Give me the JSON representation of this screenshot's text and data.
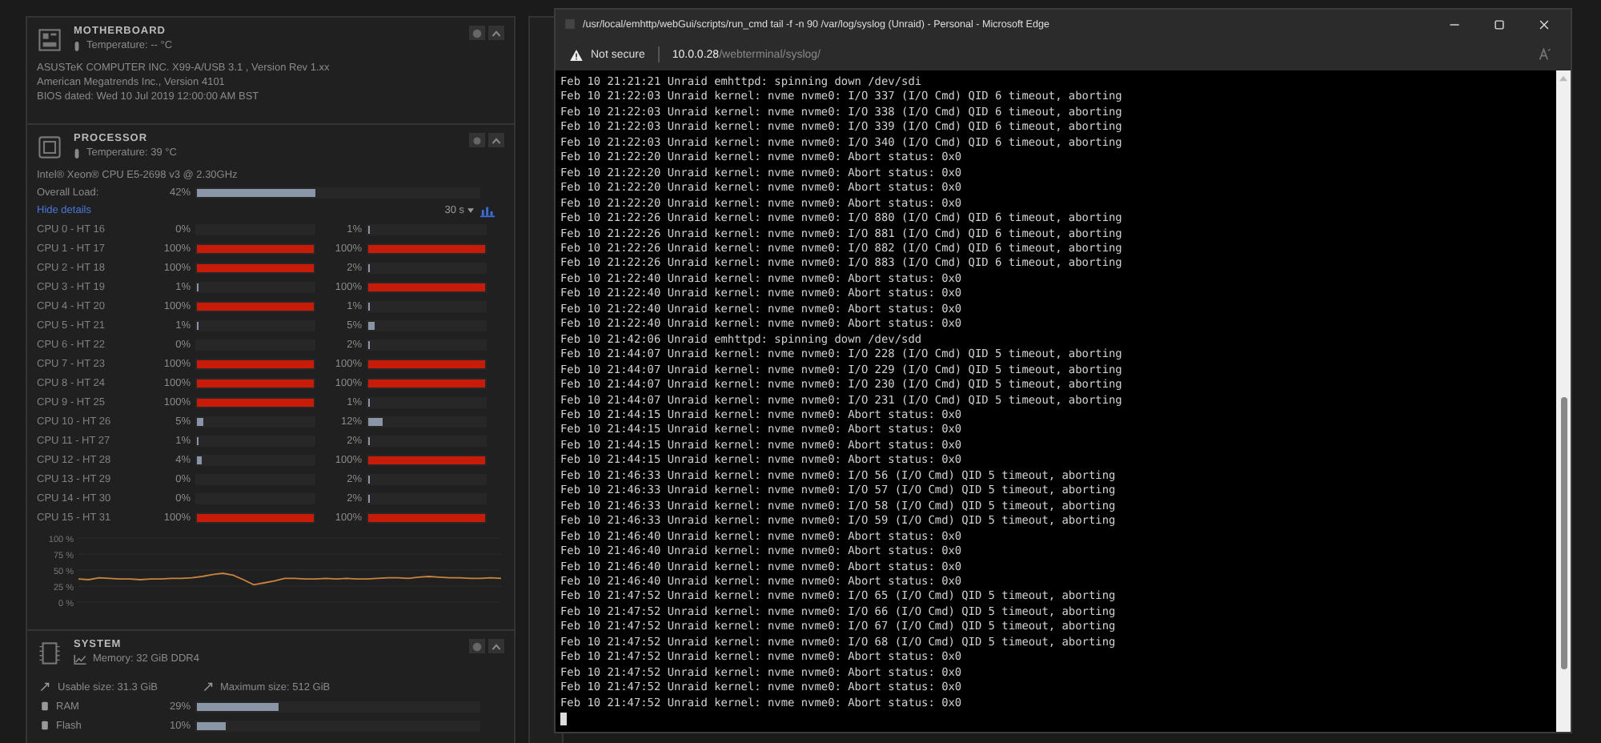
{
  "motherboard": {
    "title": "MOTHERBOARD",
    "temperature": "Temperature: -- °C",
    "lines": [
      "ASUSTeK COMPUTER INC. X99-A/USB 3.1 , Version Rev 1.xx",
      "American Megatrends Inc., Version 4101",
      "BIOS dated: Wed 10 Jul 2019 12:00:00 AM BST"
    ]
  },
  "processor": {
    "title": "PROCESSOR",
    "temperature": "Temperature: 39 °C",
    "model": "Intel® Xeon® CPU E5-2698 v3 @ 2.30GHz",
    "overall": {
      "label": "Overall Load:",
      "reading": "42%",
      "level": 0.42
    },
    "hide_details": "Hide details",
    "interval": "30 s",
    "cpus": [
      {
        "label": "CPU 0 - HT 16",
        "a": {
          "reading": "0%",
          "level": 0
        },
        "b": {
          "reading": "1%",
          "level": 0.01
        }
      },
      {
        "label": "CPU 1 - HT 17",
        "a": {
          "reading": "100%",
          "level": 1
        },
        "b": {
          "reading": "100%",
          "level": 1
        }
      },
      {
        "label": "CPU 2 - HT 18",
        "a": {
          "reading": "100%",
          "level": 1
        },
        "b": {
          "reading": "2%",
          "level": 0.02
        }
      },
      {
        "label": "CPU 3 - HT 19",
        "a": {
          "reading": "1%",
          "level": 0.01
        },
        "b": {
          "reading": "100%",
          "level": 1
        }
      },
      {
        "label": "CPU 4 - HT 20",
        "a": {
          "reading": "100%",
          "level": 1
        },
        "b": {
          "reading": "1%",
          "level": 0.01
        }
      },
      {
        "label": "CPU 5 - HT 21",
        "a": {
          "reading": "1%",
          "level": 0.01
        },
        "b": {
          "reading": "5%",
          "level": 0.05
        }
      },
      {
        "label": "CPU 6 - HT 22",
        "a": {
          "reading": "0%",
          "level": 0
        },
        "b": {
          "reading": "2%",
          "level": 0.02
        }
      },
      {
        "label": "CPU 7 - HT 23",
        "a": {
          "reading": "100%",
          "level": 1
        },
        "b": {
          "reading": "100%",
          "level": 1
        }
      },
      {
        "label": "CPU 8 - HT 24",
        "a": {
          "reading": "100%",
          "level": 1
        },
        "b": {
          "reading": "100%",
          "level": 1
        }
      },
      {
        "label": "CPU 9 - HT 25",
        "a": {
          "reading": "100%",
          "level": 1
        },
        "b": {
          "reading": "1%",
          "level": 0.01
        }
      },
      {
        "label": "CPU 10 - HT 26",
        "a": {
          "reading": "5%",
          "level": 0.05
        },
        "b": {
          "reading": "12%",
          "level": 0.12
        }
      },
      {
        "label": "CPU 11 - HT 27",
        "a": {
          "reading": "1%",
          "level": 0.01
        },
        "b": {
          "reading": "2%",
          "level": 0.02
        }
      },
      {
        "label": "CPU 12 - HT 28",
        "a": {
          "reading": "4%",
          "level": 0.04
        },
        "b": {
          "reading": "100%",
          "level": 1
        }
      },
      {
        "label": "CPU 13 - HT 29",
        "a": {
          "reading": "0%",
          "level": 0
        },
        "b": {
          "reading": "2%",
          "level": 0.02
        }
      },
      {
        "label": "CPU 14 - HT 30",
        "a": {
          "reading": "0%",
          "level": 0
        },
        "b": {
          "reading": "2%",
          "level": 0.02
        }
      },
      {
        "label": "CPU 15 - HT 31",
        "a": {
          "reading": "100%",
          "level": 1
        },
        "b": {
          "reading": "100%",
          "level": 1
        }
      }
    ],
    "chart_data": {
      "type": "line",
      "grid": true,
      "ylim": [
        0,
        100
      ],
      "yticks": [
        {
          "value": 100,
          "label": "100 %"
        },
        {
          "value": 75,
          "label": "75 %"
        },
        {
          "value": 50,
          "label": "50 %"
        },
        {
          "value": 25,
          "label": "25 %"
        },
        {
          "value": 0,
          "label": "0 %"
        }
      ],
      "values": [
        36,
        35,
        38,
        37,
        36,
        36,
        35,
        36,
        36,
        37,
        37,
        38,
        40,
        43,
        45,
        42,
        35,
        27,
        30,
        33,
        37,
        37,
        36,
        36,
        37,
        36,
        37,
        36,
        36,
        37,
        38,
        38,
        37,
        39,
        40,
        39,
        38,
        38,
        37,
        37,
        38,
        37
      ]
    }
  },
  "system": {
    "title": "SYSTEM",
    "memory": "Memory: 32 GiB DDR4",
    "usable": "Usable size: 31.3 GiB",
    "maximum": "Maximum size: 512 GiB",
    "bars": [
      {
        "label": "RAM",
        "reading": "29%",
        "level": 0.29
      },
      {
        "label": "Flash",
        "reading": "10%",
        "level": 0.1
      }
    ]
  },
  "browser": {
    "title": "/usr/local/emhttp/webGui/scripts/run_cmd tail -f -n 90 /var/log/syslog (Unraid) - Personal - Microsoft Edge",
    "security": "Not secure",
    "host": "10.0.0.28",
    "path": "/webterminal/syslog/",
    "log": [
      "Feb 10 21:21:21 Unraid emhttpd: spinning down /dev/sdi",
      "Feb 10 21:22:03 Unraid kernel: nvme nvme0: I/O 337 (I/O Cmd) QID 6 timeout, aborting",
      "Feb 10 21:22:03 Unraid kernel: nvme nvme0: I/O 338 (I/O Cmd) QID 6 timeout, aborting",
      "Feb 10 21:22:03 Unraid kernel: nvme nvme0: I/O 339 (I/O Cmd) QID 6 timeout, aborting",
      "Feb 10 21:22:03 Unraid kernel: nvme nvme0: I/O 340 (I/O Cmd) QID 6 timeout, aborting",
      "Feb 10 21:22:20 Unraid kernel: nvme nvme0: Abort status: 0x0",
      "Feb 10 21:22:20 Unraid kernel: nvme nvme0: Abort status: 0x0",
      "Feb 10 21:22:20 Unraid kernel: nvme nvme0: Abort status: 0x0",
      "Feb 10 21:22:20 Unraid kernel: nvme nvme0: Abort status: 0x0",
      "Feb 10 21:22:26 Unraid kernel: nvme nvme0: I/O 880 (I/O Cmd) QID 6 timeout, aborting",
      "Feb 10 21:22:26 Unraid kernel: nvme nvme0: I/O 881 (I/O Cmd) QID 6 timeout, aborting",
      "Feb 10 21:22:26 Unraid kernel: nvme nvme0: I/O 882 (I/O Cmd) QID 6 timeout, aborting",
      "Feb 10 21:22:26 Unraid kernel: nvme nvme0: I/O 883 (I/O Cmd) QID 6 timeout, aborting",
      "Feb 10 21:22:40 Unraid kernel: nvme nvme0: Abort status: 0x0",
      "Feb 10 21:22:40 Unraid kernel: nvme nvme0: Abort status: 0x0",
      "Feb 10 21:22:40 Unraid kernel: nvme nvme0: Abort status: 0x0",
      "Feb 10 21:22:40 Unraid kernel: nvme nvme0: Abort status: 0x0",
      "Feb 10 21:42:06 Unraid emhttpd: spinning down /dev/sdd",
      "Feb 10 21:44:07 Unraid kernel: nvme nvme0: I/O 228 (I/O Cmd) QID 5 timeout, aborting",
      "Feb 10 21:44:07 Unraid kernel: nvme nvme0: I/O 229 (I/O Cmd) QID 5 timeout, aborting",
      "Feb 10 21:44:07 Unraid kernel: nvme nvme0: I/O 230 (I/O Cmd) QID 5 timeout, aborting",
      "Feb 10 21:44:07 Unraid kernel: nvme nvme0: I/O 231 (I/O Cmd) QID 5 timeout, aborting",
      "Feb 10 21:44:15 Unraid kernel: nvme nvme0: Abort status: 0x0",
      "Feb 10 21:44:15 Unraid kernel: nvme nvme0: Abort status: 0x0",
      "Feb 10 21:44:15 Unraid kernel: nvme nvme0: Abort status: 0x0",
      "Feb 10 21:44:15 Unraid kernel: nvme nvme0: Abort status: 0x0",
      "Feb 10 21:46:33 Unraid kernel: nvme nvme0: I/O 56 (I/O Cmd) QID 5 timeout, aborting",
      "Feb 10 21:46:33 Unraid kernel: nvme nvme0: I/O 57 (I/O Cmd) QID 5 timeout, aborting",
      "Feb 10 21:46:33 Unraid kernel: nvme nvme0: I/O 58 (I/O Cmd) QID 5 timeout, aborting",
      "Feb 10 21:46:33 Unraid kernel: nvme nvme0: I/O 59 (I/O Cmd) QID 5 timeout, aborting",
      "Feb 10 21:46:40 Unraid kernel: nvme nvme0: Abort status: 0x0",
      "Feb 10 21:46:40 Unraid kernel: nvme nvme0: Abort status: 0x0",
      "Feb 10 21:46:40 Unraid kernel: nvme nvme0: Abort status: 0x0",
      "Feb 10 21:46:40 Unraid kernel: nvme nvme0: Abort status: 0x0",
      "Feb 10 21:47:52 Unraid kernel: nvme nvme0: I/O 65 (I/O Cmd) QID 5 timeout, aborting",
      "Feb 10 21:47:52 Unraid kernel: nvme nvme0: I/O 66 (I/O Cmd) QID 5 timeout, aborting",
      "Feb 10 21:47:52 Unraid kernel: nvme nvme0: I/O 67 (I/O Cmd) QID 5 timeout, aborting",
      "Feb 10 21:47:52 Unraid kernel: nvme nvme0: I/O 68 (I/O Cmd) QID 5 timeout, aborting",
      "Feb 10 21:47:52 Unraid kernel: nvme nvme0: Abort status: 0x0",
      "Feb 10 21:47:52 Unraid kernel: nvme nvme0: Abort status: 0x0",
      "Feb 10 21:47:52 Unraid kernel: nvme nvme0: Abort status: 0x0",
      "Feb 10 21:47:52 Unraid kernel: nvme nvme0: Abort status: 0x0"
    ]
  }
}
